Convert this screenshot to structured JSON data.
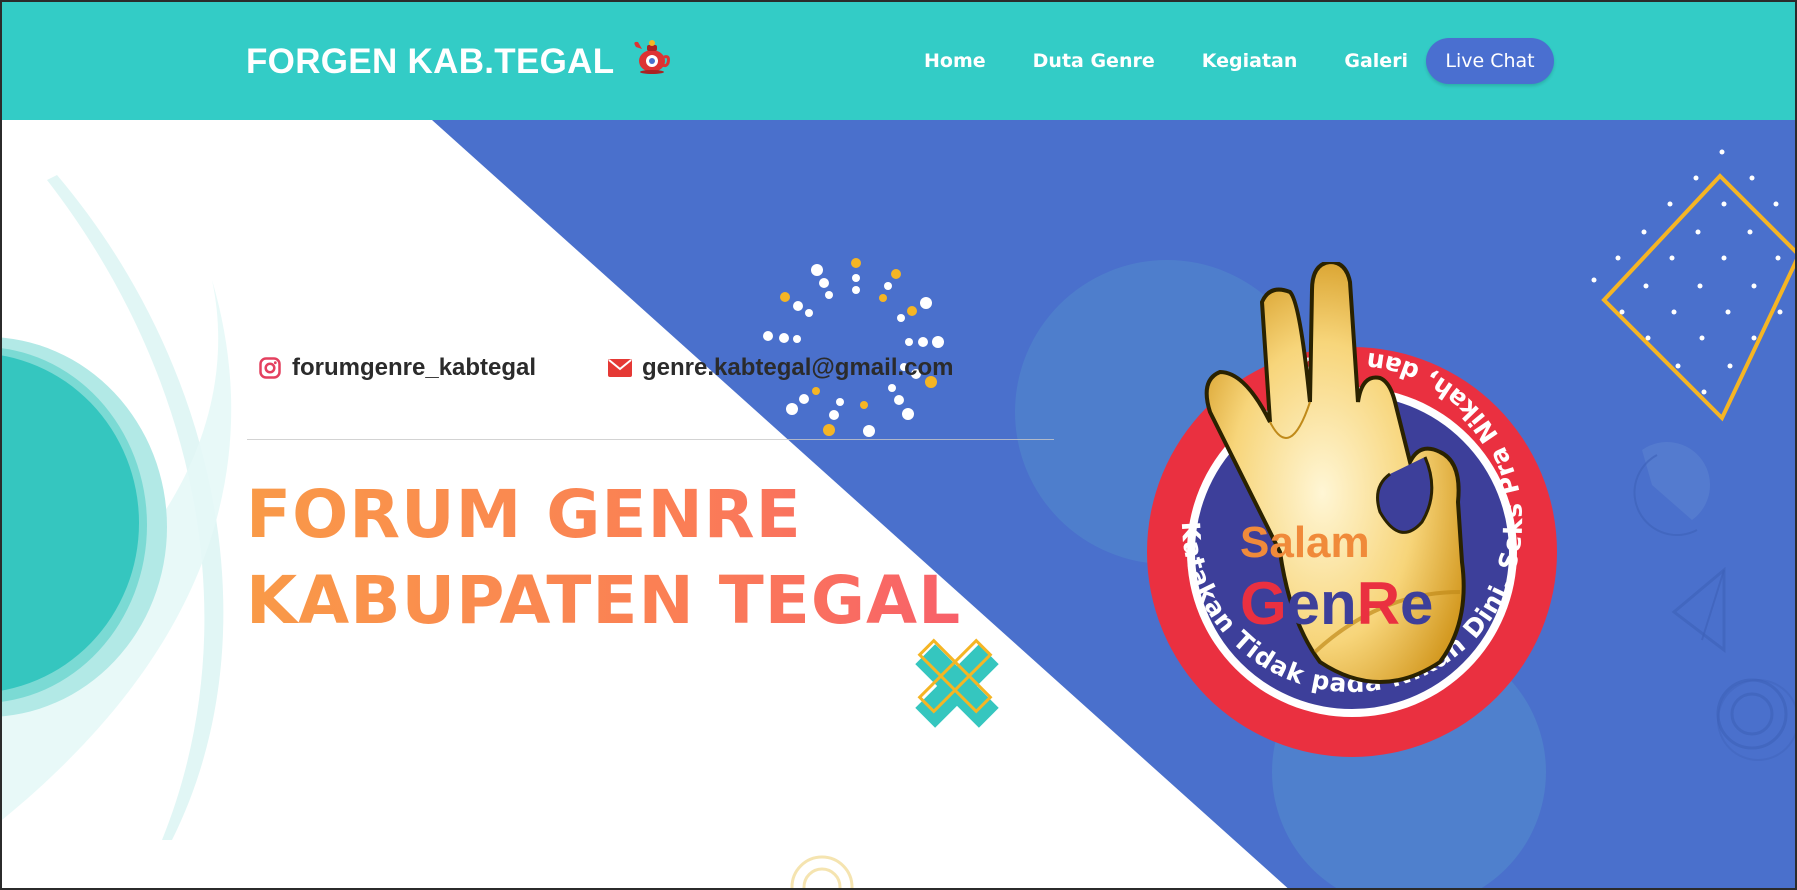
{
  "header": {
    "brand": "FORGEN KAB.TEGAL",
    "nav": [
      "Home",
      "Duta Genre",
      "Kegiatan",
      "Galeri"
    ],
    "live_chat_label": "Live Chat"
  },
  "contact": {
    "instagram": "forumgenre_kabtegal",
    "email": "genre.kabtegal@gmail.com"
  },
  "hero": {
    "title_line1": "FORUM GENRE",
    "title_line2": "KABUPATEN TEGAL"
  },
  "emblem": {
    "ring_text": "Katakan Tidak pada Nikah Dini, Seks Pra Nikah, dan Napza",
    "salam": "Salam",
    "genre_g": "G",
    "genre_en": "en",
    "genre_r": "R",
    "genre_e": "e"
  },
  "colors": {
    "header": "#33ccc6",
    "hero_blue": "#4a70cc",
    "teal": "#35c6bf",
    "orange_gradient_start": "#f99a48",
    "orange_gradient_end": "#f8606a",
    "accent_yellow": "#f5b524",
    "instagram": "#e4405f",
    "mail": "#e53935"
  }
}
